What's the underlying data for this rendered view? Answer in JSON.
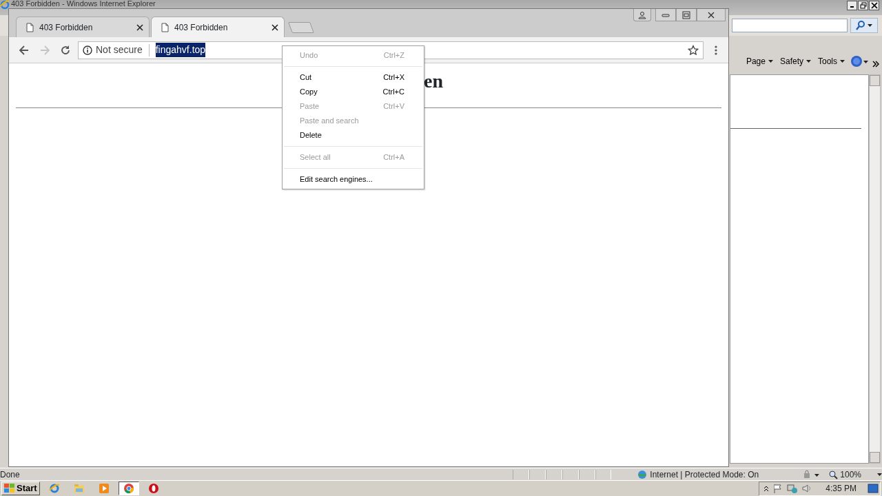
{
  "ie_window": {
    "title": "403 Forbidden - Windows Internet Explorer",
    "command_bar": [
      {
        "label": "Page"
      },
      {
        "label": "Safety"
      },
      {
        "label": "Tools"
      }
    ],
    "status_bar": {
      "text": "Done",
      "zone": "Internet | Protected Mode: On",
      "zoom": "100%"
    }
  },
  "chrome_window": {
    "tabs": [
      {
        "title": "403 Forbidden",
        "selected": false
      },
      {
        "title": "403 Forbidden",
        "selected": true
      }
    ],
    "nav_buttons": [
      {
        "kind": "back",
        "disabled": false
      },
      {
        "kind": "forward",
        "disabled": true
      },
      {
        "kind": "reload",
        "disabled": false
      }
    ],
    "security": "Not secure",
    "url": {
      "text": "fingahvf.top",
      "selected": true
    },
    "page": {
      "heading": "en"
    }
  },
  "context_menu": [
    {
      "kind": "item",
      "label": "Undo",
      "shortcut": "Ctrl+Z",
      "disabled": true
    },
    {
      "kind": "separator"
    },
    {
      "kind": "item",
      "label": "Cut",
      "shortcut": "Ctrl+X",
      "disabled": false
    },
    {
      "kind": "item",
      "label": "Copy",
      "shortcut": "Ctrl+C",
      "disabled": false
    },
    {
      "kind": "item",
      "label": "Paste",
      "shortcut": "Ctrl+V",
      "disabled": true
    },
    {
      "kind": "item",
      "label": "Paste and search",
      "disabled": true
    },
    {
      "kind": "item",
      "label": "Delete",
      "disabled": false
    },
    {
      "kind": "separator"
    },
    {
      "kind": "item",
      "label": "Select all",
      "shortcut": "Ctrl+A",
      "disabled": true
    },
    {
      "kind": "separator"
    },
    {
      "kind": "item",
      "label": "Edit search engines...",
      "disabled": false
    }
  ],
  "taskbar": {
    "start": "Start",
    "apps": [
      {
        "kind": "ie",
        "selected": false
      },
      {
        "kind": "folder",
        "selected": false
      },
      {
        "kind": "media",
        "selected": false
      },
      {
        "kind": "chrome",
        "selected": true
      },
      {
        "kind": "opera",
        "selected": false
      }
    ],
    "clock": "4:35 PM"
  }
}
